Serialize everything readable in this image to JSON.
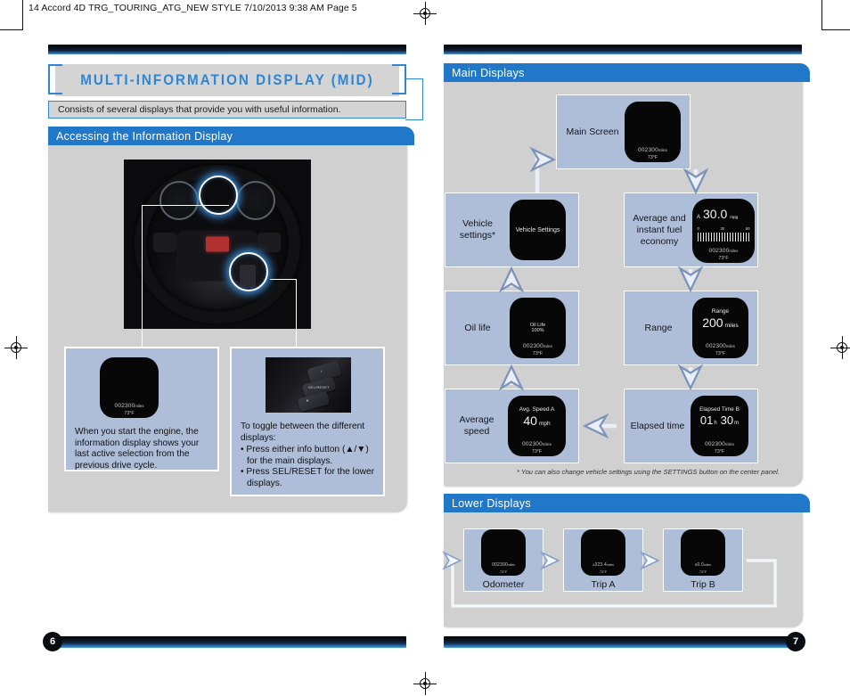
{
  "print_header": "14 Accord 4D TRG_TOURING_ATG_NEW STYLE  7/10/2013  9:38 AM  Page 5",
  "colors": {
    "accent_blue": "#2178c8",
    "title_blue": "#2f86d4",
    "panel_gray": "#d0d0d0",
    "card_blue": "#aebdd8"
  },
  "left_page": {
    "title": "MULTI-INFORMATION DISPLAY (MID)",
    "subtitle": "Consists of several displays that provide you with useful information.",
    "section": {
      "heading": "Accessing the Information Display"
    },
    "info_left": {
      "text": "When you start the engine, the information display shows your last active selection from the previous drive cycle.",
      "screen": {
        "odometer": "002300",
        "unit": "miles",
        "temp": "73°F"
      }
    },
    "info_right": {
      "intro": "To toggle between the different displays:",
      "bullets": [
        "• Press either info button (▲/▼) for the main displays.",
        "• Press SEL/RESET for the lower displays."
      ],
      "button_labels": {
        "top": "i",
        "mid": "SEL/RESET",
        "bottom": "▼"
      }
    },
    "page_number": "6"
  },
  "right_page": {
    "main_displays": {
      "heading": "Main Displays",
      "footnote": "* You can also change vehicle settings using the SETTINGS button on the center panel.",
      "cards": [
        {
          "label": "Main Screen",
          "screen": {
            "kind": "blank",
            "odometer": "002300",
            "unit": "miles",
            "temp": "73°F"
          }
        },
        {
          "label": "Vehicle settings*",
          "screen": {
            "kind": "text-only",
            "caption": "Vehicle Settings"
          }
        },
        {
          "label": "Average and instant fuel economy",
          "screen": {
            "kind": "fuel",
            "trip": "A",
            "value": "30.0",
            "value_unit": "mpg",
            "scale_labels": [
              "0",
              "30",
              "60"
            ],
            "odometer": "002300",
            "unit": "miles",
            "temp": "73°F"
          }
        },
        {
          "label": "Oil life",
          "screen": {
            "kind": "two-line",
            "line1": "Oil Life",
            "line2": "100%",
            "odometer": "002300",
            "unit": "miles",
            "temp": "73°F"
          }
        },
        {
          "label": "Range",
          "screen": {
            "kind": "caption-value",
            "caption": "Range",
            "value": "200",
            "value_unit": "miles",
            "odometer": "002300",
            "unit": "miles",
            "temp": "73°F"
          }
        },
        {
          "label": "Average speed",
          "screen": {
            "kind": "caption-value",
            "caption": "Avg. Speed A",
            "value": "40",
            "value_unit": "mph",
            "odometer": "002300",
            "unit": "miles",
            "temp": "73°F"
          }
        },
        {
          "label": "Elapsed time",
          "screen": {
            "kind": "time",
            "caption": "Elapsed Time B",
            "hours": "01",
            "hours_unit": "h",
            "minutes": "30",
            "minutes_unit": "m",
            "odometer": "002300",
            "unit": "miles",
            "temp": "73°F"
          }
        }
      ]
    },
    "lower_displays": {
      "heading": "Lower Displays",
      "cards": [
        {
          "label": "Odometer",
          "screen": {
            "value": "002300",
            "unit": "miles",
            "temp": "73°F"
          }
        },
        {
          "label": "Trip A",
          "screen": {
            "prefix": "A",
            "value": "323.4",
            "unit": "miles",
            "temp": "73°F"
          }
        },
        {
          "label": "Trip B",
          "screen": {
            "prefix": "B",
            "value": "0.0",
            "unit": "miles",
            "temp": "73°F"
          }
        }
      ]
    },
    "page_number": "7"
  }
}
